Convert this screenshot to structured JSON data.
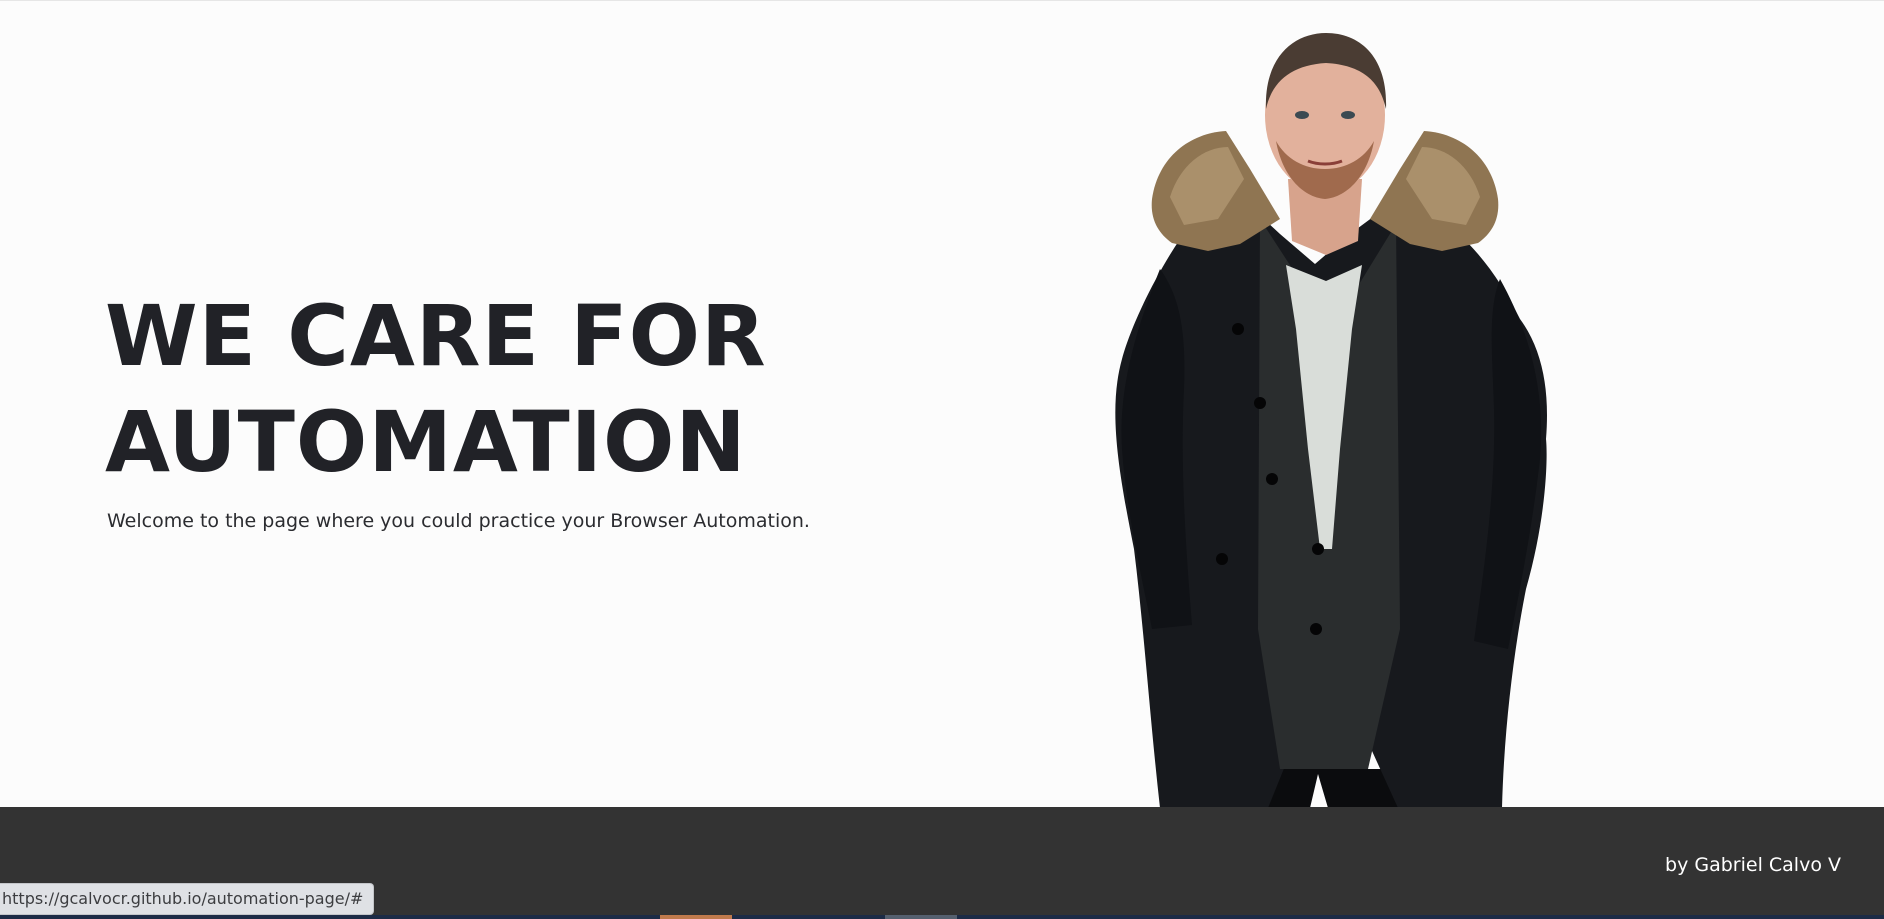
{
  "hero": {
    "title": "WE CARE FOR AUTOMATION",
    "subtitle": "Welcome to the page where you could practice your Browser Automation."
  },
  "footer": {
    "credit": "by Gabriel Calvo V"
  },
  "status_bar": {
    "url": "https://gcalvocr.github.io/automation-page/#"
  },
  "colors": {
    "hero_background": "#fcfcfc",
    "heading_text": "#212227",
    "footer_background": "#333333",
    "footer_text": "#ffffff",
    "jacket": "#17191d",
    "fur_collar": "#8f7552"
  },
  "icons": {
    "hero_image": "person-in-parka-photo"
  }
}
